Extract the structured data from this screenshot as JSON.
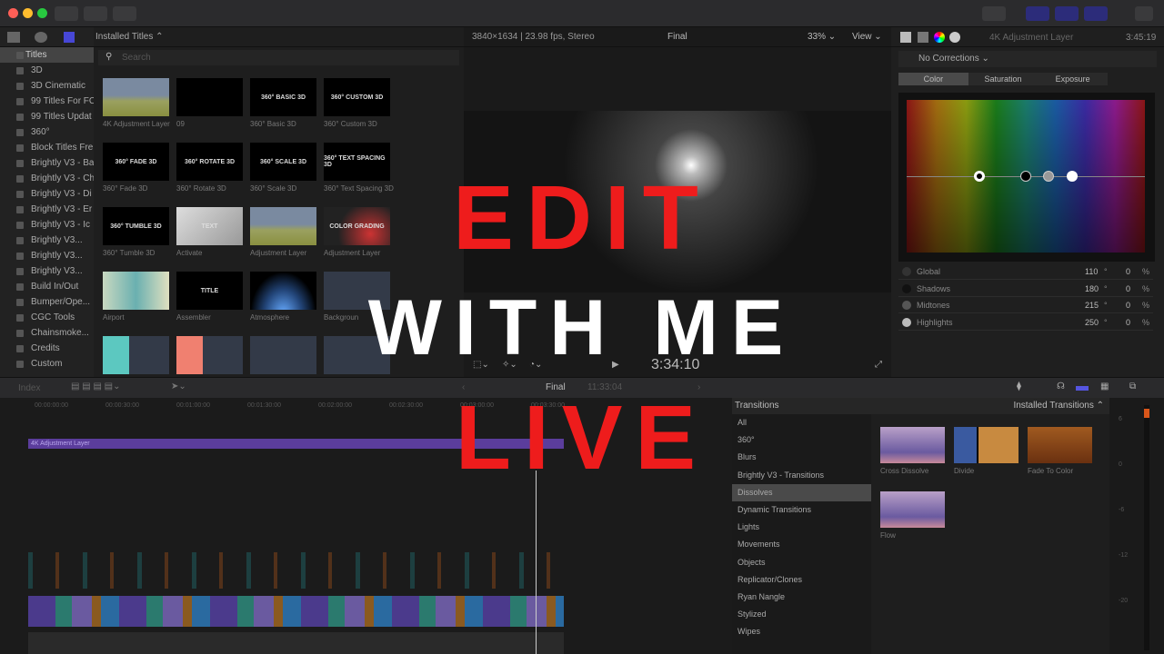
{
  "browser": {
    "header": "Installed Titles",
    "search_placeholder": "Search",
    "sidebar": [
      "Titles",
      "3D",
      "3D Cinematic",
      "99 Titles For FC",
      "99 Titles Updat",
      "360°",
      "Block Titles Fre",
      "Brightly V3 - Ba",
      "Brightly V3 - Ch",
      "Brightly V3 - Di",
      "Brightly V3 - Er",
      "Brightly V3 - Ic",
      "Brightly V3...",
      "Brightly V3...",
      "Brightly V3...",
      "Build In/Out",
      "Bumper/Ope...",
      "CGC Tools",
      "Chainsmoke...",
      "Credits",
      "Custom"
    ],
    "thumbnails": [
      {
        "label": "4K Adjustment Layer",
        "text": ""
      },
      {
        "label": "09",
        "text": ""
      },
      {
        "label": "360° Basic 3D",
        "text": "360° BASIC 3D"
      },
      {
        "label": "360° Custom 3D",
        "text": "360° CUSTOM 3D"
      },
      {
        "label": "360° Fade 3D",
        "text": "360° FADE 3D"
      },
      {
        "label": "360° Rotate 3D",
        "text": "360° ROTATE 3D"
      },
      {
        "label": "360° Scale 3D",
        "text": "360° SCALE 3D"
      },
      {
        "label": "360° Text Spacing 3D",
        "text": "360° TEXT SPACING 3D"
      },
      {
        "label": "360° Tumble 3D",
        "text": "360° TUMBLE 3D"
      },
      {
        "label": "Activate",
        "text": "TEXT"
      },
      {
        "label": "Adjustment Layer",
        "text": ""
      },
      {
        "label": "Adjustment Layer",
        "text": "COLOR GRADING"
      },
      {
        "label": "Airport",
        "text": ""
      },
      {
        "label": "Assembler",
        "text": "TITLE"
      },
      {
        "label": "Atmosphere",
        "text": ""
      },
      {
        "label": "Backgroun",
        "text": ""
      }
    ]
  },
  "viewer": {
    "format": "3840×1634 | 23.98 fps, Stereo",
    "project": "Final",
    "zoom": "33%",
    "view": "View",
    "timecode": "3:34:10"
  },
  "inspector": {
    "title": "4K Adjustment Layer",
    "duration": "3:45:19",
    "corrections": "No Corrections",
    "tabs": [
      "Color",
      "Saturation",
      "Exposure"
    ],
    "active_tab": "Color",
    "rows": [
      {
        "name": "Global",
        "angle": "110",
        "pct": "0"
      },
      {
        "name": "Shadows",
        "angle": "180",
        "pct": "0"
      },
      {
        "name": "Midtones",
        "angle": "215",
        "pct": "0"
      },
      {
        "name": "Highlights",
        "angle": "250",
        "pct": "0"
      }
    ],
    "deg": "°",
    "pct_sign": "%"
  },
  "timeline": {
    "index": "Index",
    "project": "Final",
    "duration": "11:33:04",
    "ruler": [
      "00:00:00:00",
      "00:00:30:00",
      "00:01:00:00",
      "00:01:30:00",
      "00:02:00:00",
      "00:02:30:00",
      "00:03:00:00",
      "00:03:30:00"
    ],
    "adjustment_clip": "4K Adjustment Layer"
  },
  "transitions": {
    "header": "Transitions",
    "installed": "Installed Transitions",
    "categories": [
      "All",
      "360°",
      "Blurs",
      "Brightly V3 - Transitions",
      "Dissolves",
      "Dynamic Transitions",
      "Lights",
      "Movements",
      "Objects",
      "Replicator/Clones",
      "Ryan Nangle",
      "Stylized",
      "Wipes"
    ],
    "selected": "Dissolves",
    "items": [
      "Cross Dissolve",
      "Divide",
      "Fade To Color",
      "Flow"
    ]
  },
  "meters": {
    "labels": [
      "6",
      "0",
      "-6",
      "-12",
      "-20"
    ]
  },
  "overlay": {
    "line1": "EDIT",
    "line2": "WITH ME",
    "line3": "LIVE",
    "red": "#ee1c1c",
    "white": "#ffffff"
  }
}
